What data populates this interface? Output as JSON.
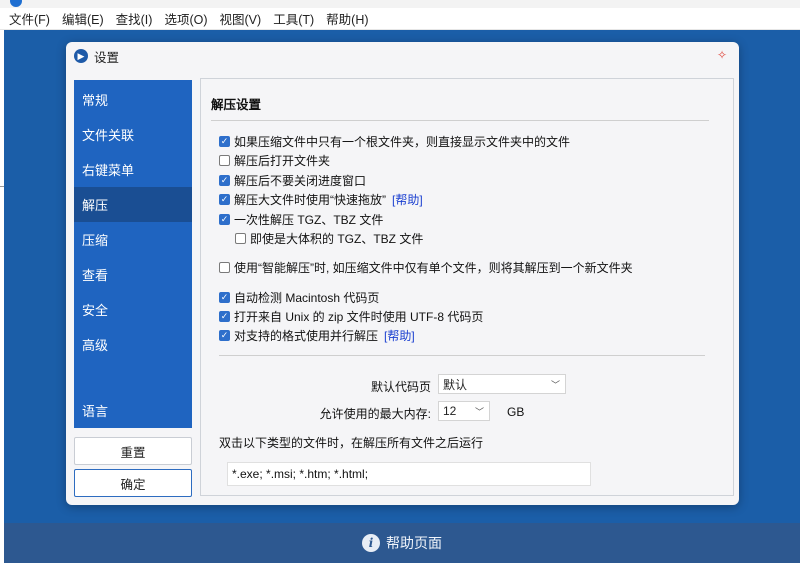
{
  "menubar": [
    "文件(F)",
    "编辑(E)",
    "查找(I)",
    "选项(O)",
    "视图(V)",
    "工具(T)",
    "帮助(H)"
  ],
  "dialog": {
    "title": "设置"
  },
  "sidebar": {
    "items": [
      "常规",
      "文件关联",
      "右键菜单",
      "解压",
      "压缩",
      "查看",
      "安全",
      "高级"
    ],
    "language": "语言",
    "active": "解压"
  },
  "buttons": {
    "reset": "重置",
    "ok": "确定"
  },
  "content": {
    "section_title": "解压设置",
    "options": [
      {
        "label": "如果压缩文件中只有一个根文件夹，则直接显示文件夹中的文件",
        "checked": true
      },
      {
        "label": "解压后打开文件夹",
        "checked": false
      },
      {
        "label": "解压后不要关闭进度窗口",
        "checked": true
      },
      {
        "label": "解压大文件时使用“快速拖放”",
        "checked": true,
        "link": "[帮助]"
      },
      {
        "label": "一次性解压 TGZ、TBZ 文件",
        "checked": true
      },
      {
        "label": "即使是大体积的 TGZ、TBZ 文件",
        "checked": false
      },
      {
        "label": "使用“智能解压”时, 如压缩文件中仅有单个文件，则将其解压到一个新文件夹",
        "checked": false
      },
      {
        "label": "自动检测 Macintosh 代码页",
        "checked": true
      },
      {
        "label": "打开来自 Unix 的 zip 文件时使用 UTF-8 代码页",
        "checked": true
      },
      {
        "label": "对支持的格式使用并行解压",
        "checked": true,
        "link": "[帮助]"
      }
    ],
    "codepage_label": "默认代码页",
    "codepage_value": "默认",
    "memory_label": "允许使用的最大内存:",
    "memory_value": "12",
    "memory_unit": "GB",
    "run_after_label": "双击以下类型的文件时，在解压所有文件之后运行",
    "run_after_value": "*.exe; *.msi; *.htm; *.html;"
  },
  "helpbar": {
    "label": "帮助页面"
  },
  "colors": {
    "main_bg": "#1b5ea8",
    "sidebar": "#1f64c0",
    "sidebar_active": "#1a4e93",
    "checkbox": "#2e6fcb",
    "link": "#1a3fd0"
  }
}
